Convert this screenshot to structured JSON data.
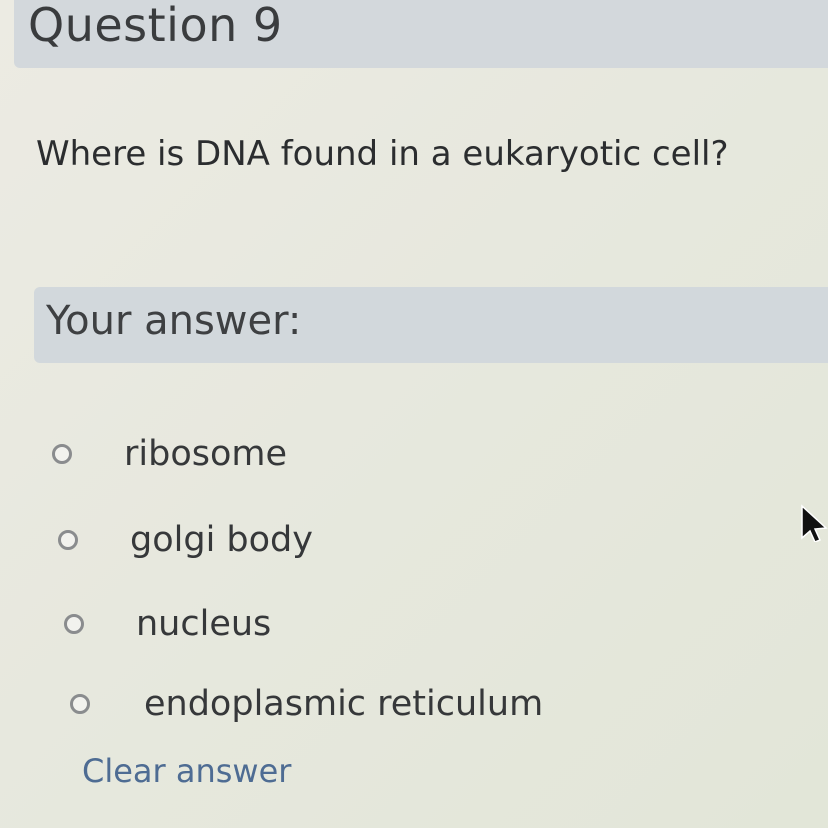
{
  "question": {
    "title": "Question 9",
    "text": "Where is DNA found in a eukaryotic cell?"
  },
  "answer": {
    "header": "Your answer:",
    "options": [
      {
        "label": "ribosome",
        "selected": false
      },
      {
        "label": "golgi body",
        "selected": false
      },
      {
        "label": "nucleus",
        "selected": false
      },
      {
        "label": "endoplasmic reticulum",
        "selected": false
      }
    ],
    "clear_label": "Clear answer"
  },
  "colors": {
    "header_background": "#d3d8dc",
    "link": "#4e6c93",
    "page_background": "#e7e8de"
  },
  "icons": {
    "cursor": "mouse-pointer-icon",
    "radio": "radio-button-icon"
  }
}
